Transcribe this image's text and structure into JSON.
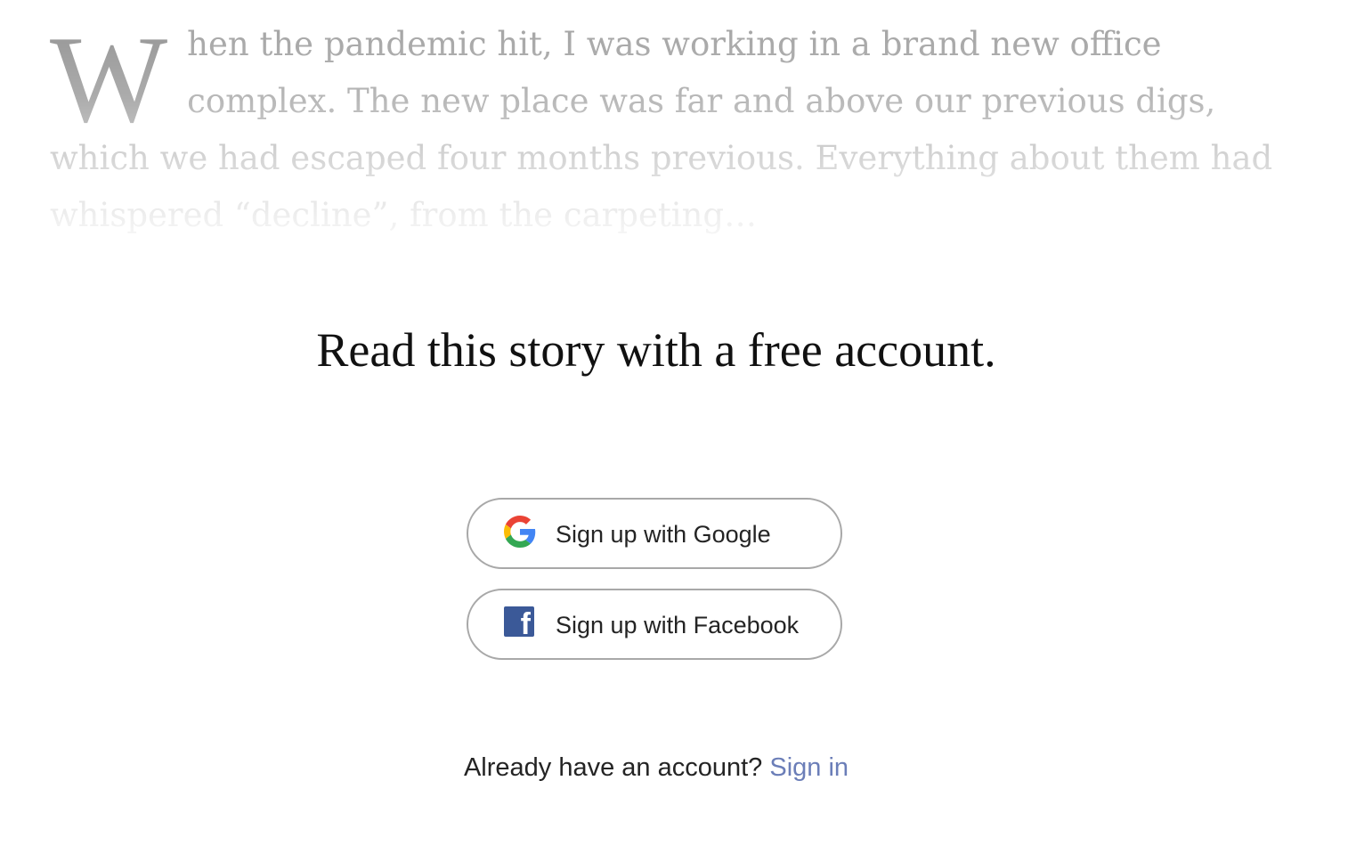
{
  "preview": {
    "drop_cap": "W",
    "text": "hen the pandemic hit, I was working in a brand new office complex. The new place was far and above our previous digs, which we had escaped four months previous. Everything about them had whispered “decline”, from the carpeting…"
  },
  "headline": "Read this story with a free account.",
  "buttons": {
    "google": {
      "label": "Sign up with Google",
      "icon": "google-icon"
    },
    "facebook": {
      "label": "Sign up with Facebook",
      "icon": "facebook-icon",
      "icon_glyph": "f"
    }
  },
  "signin": {
    "prompt": "Already have an account?",
    "link": "Sign in"
  },
  "colors": {
    "link": "#6b7eb8",
    "facebook_blue": "#3b5998",
    "google_blue": "#4285F4",
    "google_red": "#EA4335",
    "google_yellow": "#FBBC05",
    "google_green": "#34A853"
  }
}
